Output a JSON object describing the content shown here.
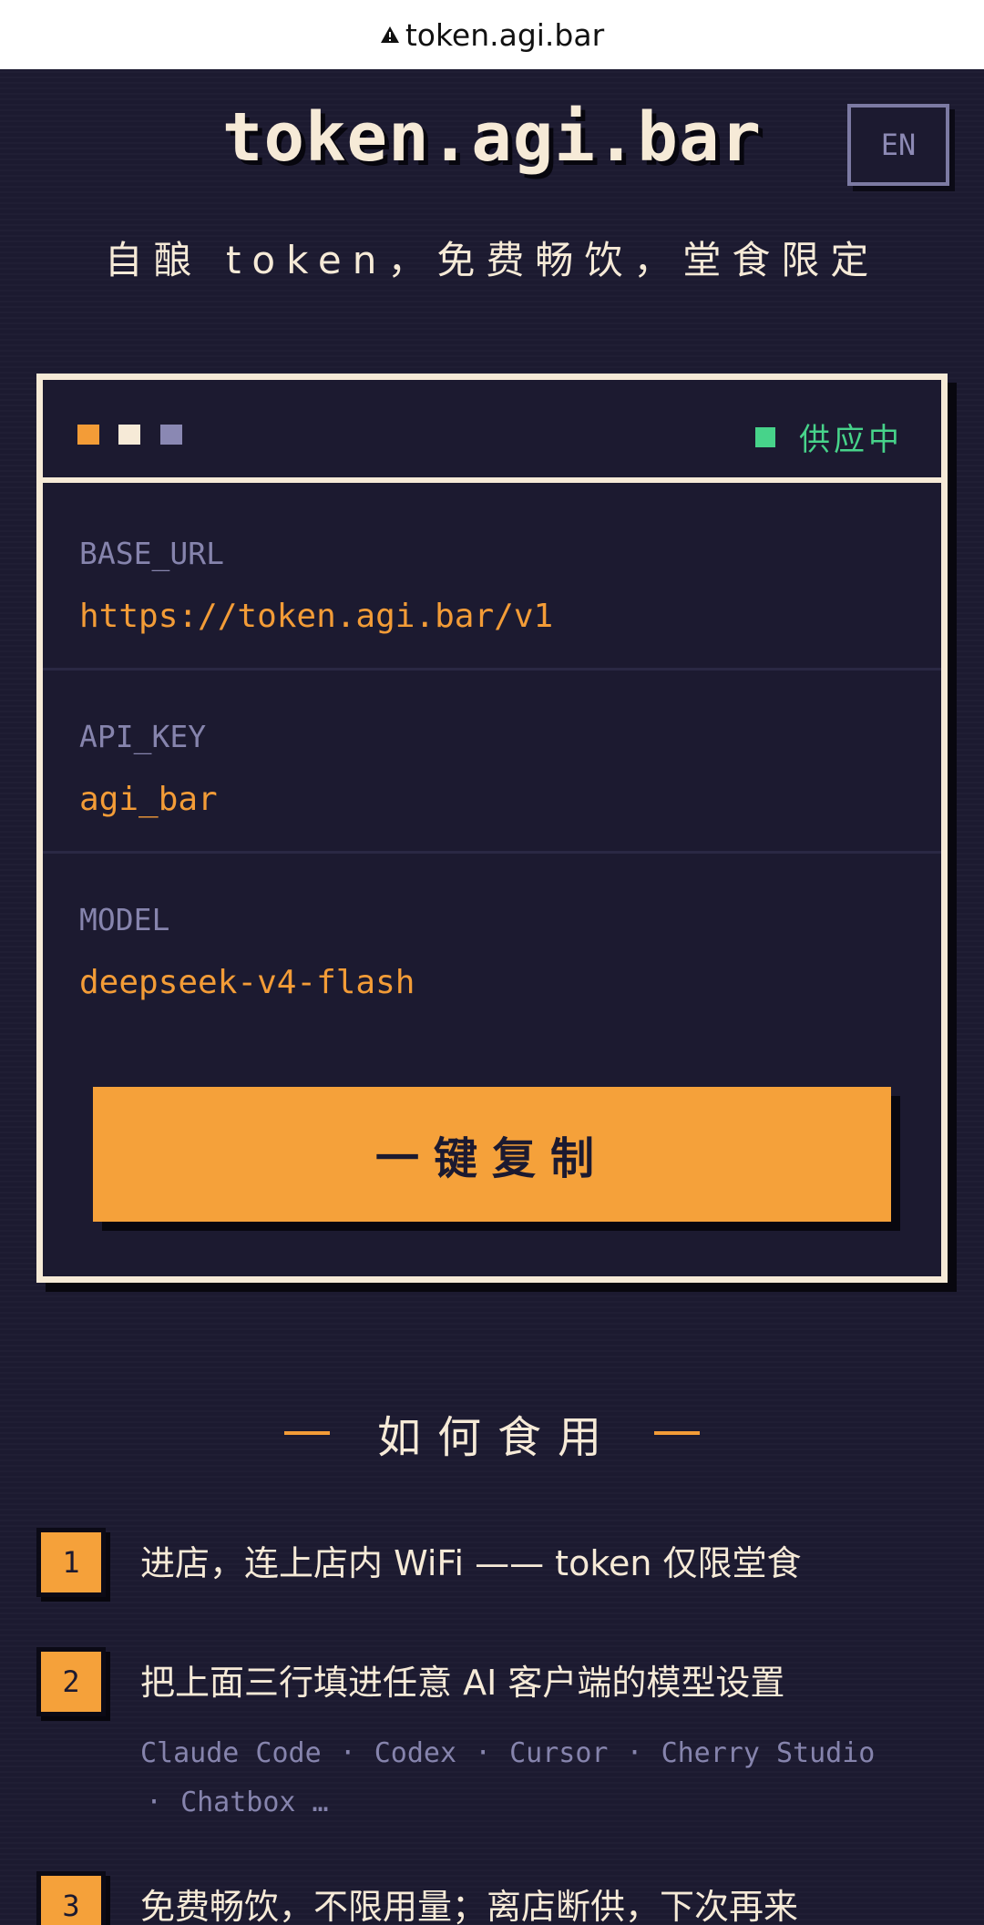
{
  "browser": {
    "url": "token.agi.bar"
  },
  "header": {
    "title": "token.agi.bar",
    "lang_button": "EN",
    "tagline": "自酿 token，免费畅饮，堂食限定"
  },
  "card": {
    "status": "供应中",
    "fields": [
      {
        "label": "BASE_URL",
        "value": "https://token.agi.bar/v1"
      },
      {
        "label": "API_KEY",
        "value": "agi_bar"
      },
      {
        "label": "MODEL",
        "value": "deepseek-v4-flash"
      }
    ],
    "copy_button": "一键复制"
  },
  "howto": {
    "title": "如何食用",
    "steps": [
      {
        "num": "1",
        "text": "进店，连上店内 WiFi —— token 仅限堂食"
      },
      {
        "num": "2",
        "text": "把上面三行填进任意 AI 客户端的模型设置",
        "clients": [
          "Claude Code",
          "Codex",
          "Cursor",
          "Cherry Studio",
          "Chatbox …"
        ]
      },
      {
        "num": "3",
        "text": "免费畅饮，不限用量；离店断供，下次再来"
      }
    ]
  },
  "colors": {
    "background": "#1c1a30",
    "accent": "#f5a13a",
    "cream": "#f6ead7",
    "muted": "#8684ad",
    "status_green": "#47d38a"
  }
}
